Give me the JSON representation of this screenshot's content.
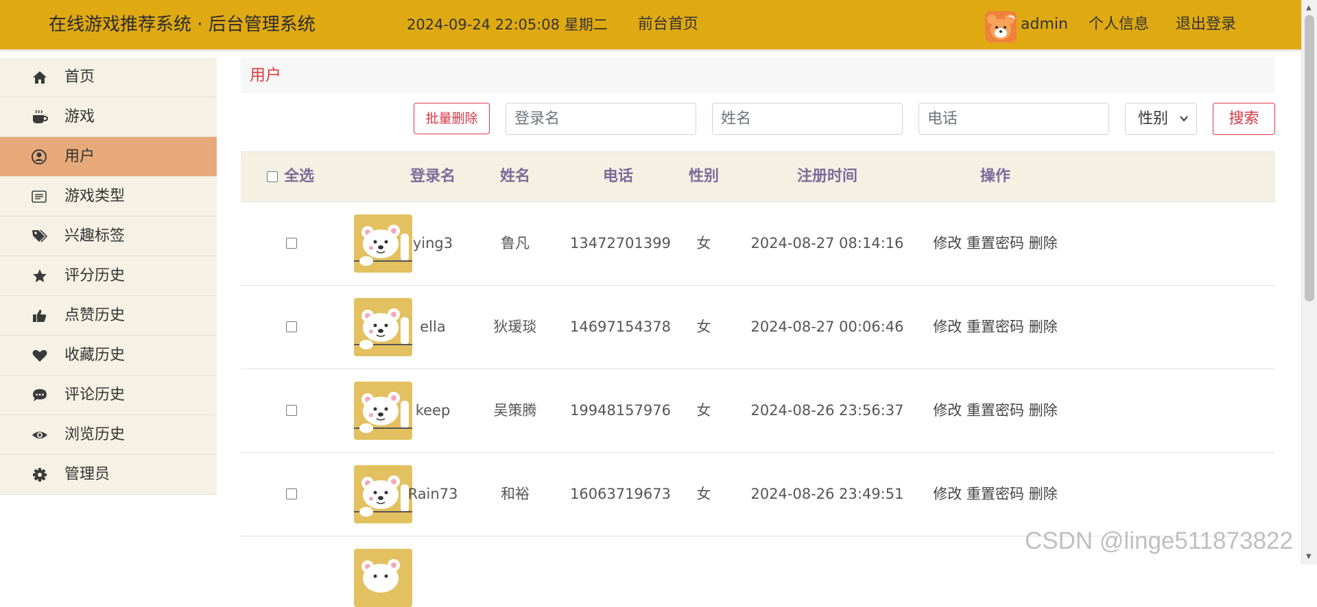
{
  "header": {
    "brand": "在线游戏推荐系统 · 后台管理系统",
    "datetime": "2024-09-24  22:05:08  星期二",
    "front_link": "前台首页",
    "username": "admin",
    "profile": "个人信息",
    "logout": "退出登录"
  },
  "sidebar": {
    "items": [
      {
        "label": "首页",
        "icon": "home-icon"
      },
      {
        "label": "游戏",
        "icon": "coffee-icon"
      },
      {
        "label": "用户",
        "icon": "user-circle-icon",
        "active": true
      },
      {
        "label": "游戏类型",
        "icon": "list-icon"
      },
      {
        "label": "兴趣标签",
        "icon": "tags-icon"
      },
      {
        "label": "评分历史",
        "icon": "star-icon"
      },
      {
        "label": "点赞历史",
        "icon": "thumbs-up-icon"
      },
      {
        "label": "收藏历史",
        "icon": "heart-icon"
      },
      {
        "label": "评论历史",
        "icon": "comment-icon"
      },
      {
        "label": "浏览历史",
        "icon": "eye-icon"
      },
      {
        "label": "管理员",
        "icon": "gear-icon"
      }
    ]
  },
  "breadcrumb": "用户",
  "toolbar": {
    "batch_delete": "批量删除",
    "login_placeholder": "登录名",
    "name_placeholder": "姓名",
    "phone_placeholder": "电话",
    "gender_select": "性别",
    "search": "搜索"
  },
  "table": {
    "headers": {
      "select_all": "全选",
      "login": "登录名",
      "name": "姓名",
      "phone": "电话",
      "gender": "性别",
      "registered": "注册时间",
      "actions": "操作"
    },
    "rows": [
      {
        "login": "ying3",
        "name": "鲁凡",
        "phone": "13472701399",
        "gender": "女",
        "registered": "2024-08-27 08:14:16"
      },
      {
        "login": "ella",
        "name": "狄瑗琰",
        "phone": "14697154378",
        "gender": "女",
        "registered": "2024-08-27 00:06:46"
      },
      {
        "login": "keep",
        "name": "吴策腾",
        "phone": "19948157976",
        "gender": "女",
        "registered": "2024-08-26 23:56:37"
      },
      {
        "login": "Rain73",
        "name": "和裕",
        "phone": "16063719673",
        "gender": "女",
        "registered": "2024-08-26 23:49:51"
      }
    ],
    "row_actions": {
      "edit": "修改",
      "reset": "重置密码",
      "delete": "删除"
    }
  },
  "watermark": "CSDN @linge511873822"
}
